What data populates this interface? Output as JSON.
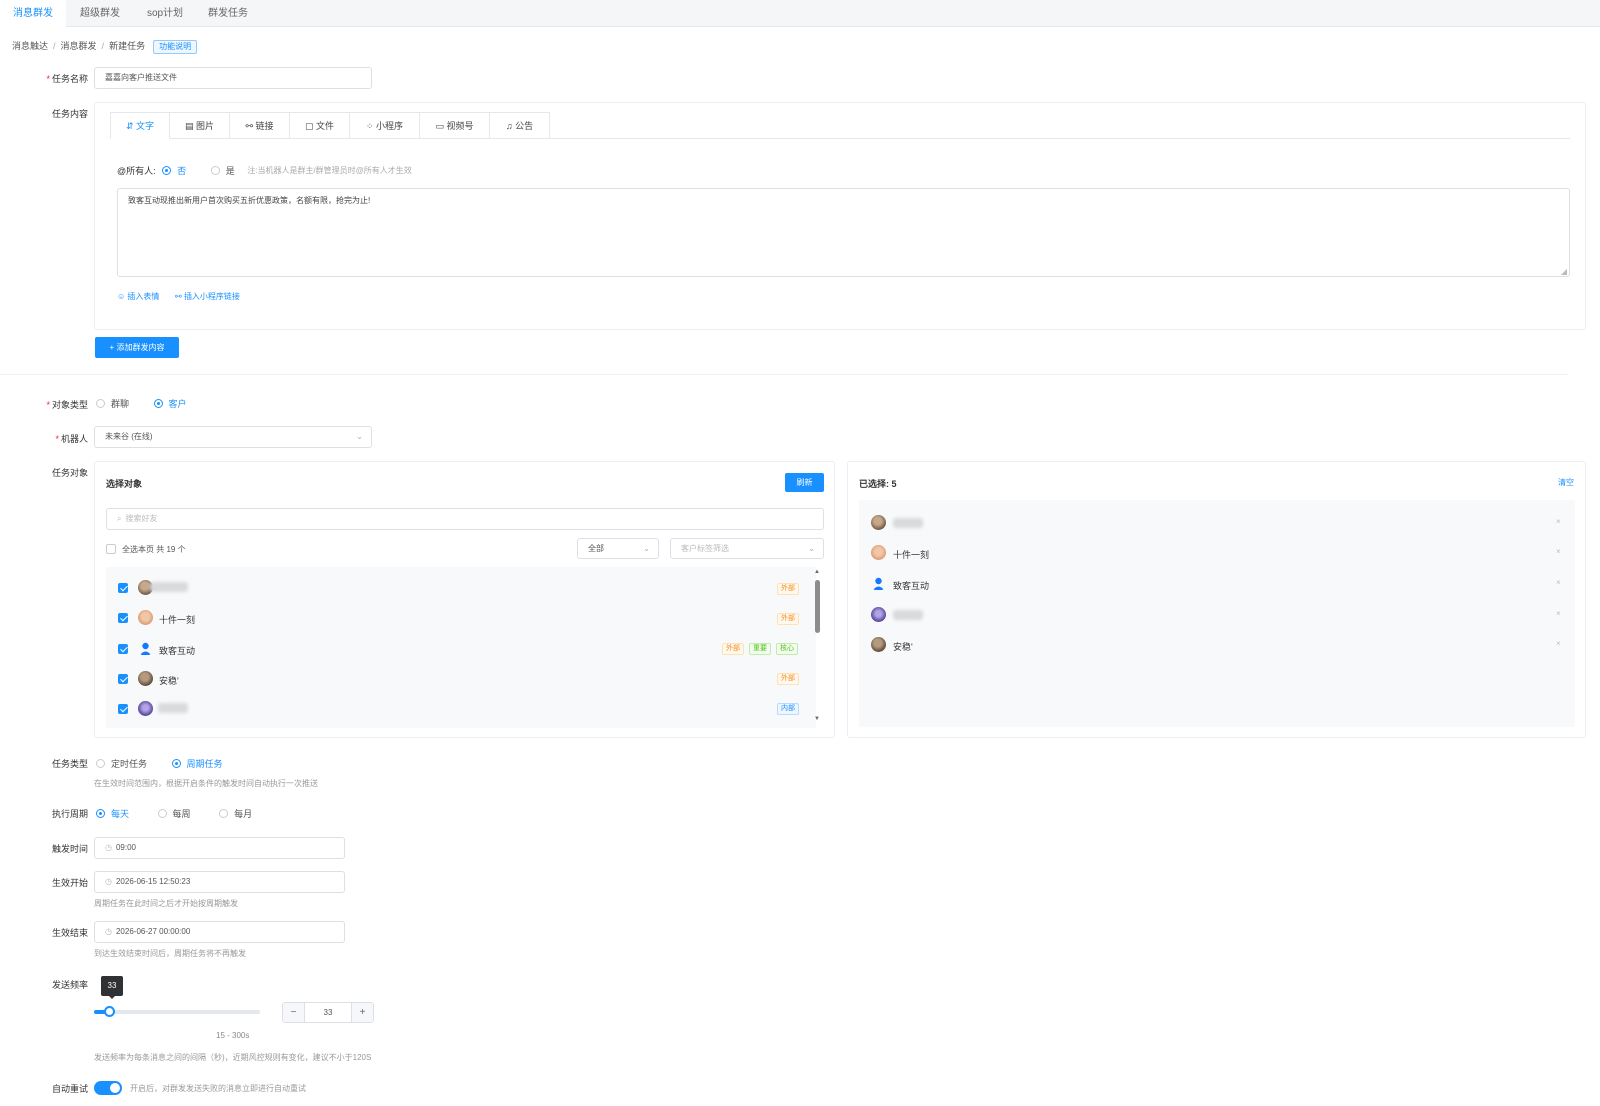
{
  "top_tabs": [
    "消息群发",
    "超级群发",
    "sop计划",
    "群发任务"
  ],
  "breadcrumb": {
    "items": [
      "消息触达",
      "消息群发",
      "新建任务"
    ],
    "help": "功能说明"
  },
  "form": {
    "task_name_label": "任务名称",
    "task_name_value": "嘉嘉向客户推送文件",
    "content_label": "任务内容",
    "content_tabs": [
      {
        "icon": "⇵",
        "label": "文字"
      },
      {
        "icon": "▤",
        "label": "图片"
      },
      {
        "icon": "⚯",
        "label": "链接"
      },
      {
        "icon": "▢",
        "label": "文件"
      },
      {
        "icon": "⁘",
        "label": "小程序"
      },
      {
        "icon": "▭",
        "label": "视频号"
      },
      {
        "icon": "♫",
        "label": "公告"
      }
    ],
    "at_all_label": "@所有人:",
    "at_all_options": [
      "否",
      "是"
    ],
    "at_all_note": "注:当机器人是群主/群管理员时@所有人才生效",
    "message_text": "致客互动现推出新用户首次购买五折优惠政策，名额有限，抢完为止!",
    "insert_emoji": "插入表情",
    "insert_miniprogram": "插入小程序链接",
    "add_content_button": "+ 添加群发内容",
    "target_type_label": "对象类型",
    "target_type_options": [
      "群聊",
      "客户"
    ],
    "robot_label": "机器人",
    "robot_value": "未来谷 (在线)",
    "task_target_label": "任务对象",
    "task_type_label": "任务类型",
    "task_type_options": [
      "定时任务",
      "周期任务"
    ],
    "task_type_hint": "在生效时间范围内，根据开启条件的触发时间自动执行一次推送",
    "cycle_label": "执行周期",
    "cycle_options": [
      "每天",
      "每周",
      "每月"
    ],
    "trigger_time_label": "触发时间",
    "trigger_time_value": "09:00",
    "start_label": "生效开始",
    "start_value": "2026-06-15 12:50:23",
    "start_hint": "周期任务在此时间之后才开始按周期触发",
    "end_label": "生效结束",
    "end_value": "2026-06-27 00:00:00",
    "end_hint": "到达生效结束时间后，周期任务将不再触发",
    "freq_label": "发送频率",
    "freq_value": "33",
    "freq_fraction": 0.06,
    "freq_range": "15 - 300s",
    "freq_hint": "发送频率为每条消息之间的间隔（秒)，近期风控规则有变化，建议不小于120S",
    "auto_retry_label": "自动重试",
    "auto_retry_hint": "开启后，对群发发送失败的消息立即进行自动重试"
  },
  "selector": {
    "title": "选择对象",
    "refresh": "刷新",
    "search_placeholder": "搜索好友",
    "select_all": "全选本页 共 19 个",
    "filter_all": "全部",
    "filter_tag_placeholder": "客户标签筛选",
    "rows": [
      {
        "name": "",
        "blur": true,
        "tags": [
          {
            "text": "外部",
            "color": "orange"
          }
        ]
      },
      {
        "name": "十件一刻",
        "blur": false,
        "tags": [
          {
            "text": "外部",
            "color": "orange"
          }
        ]
      },
      {
        "name": "致客互动",
        "blur": false,
        "tags": [
          {
            "text": "外部",
            "color": "orange"
          },
          {
            "text": "重要",
            "color": "green"
          },
          {
            "text": "核心",
            "color": "green"
          }
        ]
      },
      {
        "name": "安稳'",
        "blur": false,
        "tags": [
          {
            "text": "外部",
            "color": "orange"
          }
        ]
      },
      {
        "name": "",
        "blur": true,
        "tags": [
          {
            "text": "内部",
            "color": "blue"
          }
        ]
      }
    ]
  },
  "selected": {
    "title": "已选择: 5",
    "clear": "清空",
    "items": [
      {
        "name": "",
        "blur": true
      },
      {
        "name": "十件一刻",
        "blur": false
      },
      {
        "name": "致客互动",
        "blur": false
      },
      {
        "name": "",
        "blur": true
      },
      {
        "name": "安稳'",
        "blur": false
      }
    ]
  }
}
